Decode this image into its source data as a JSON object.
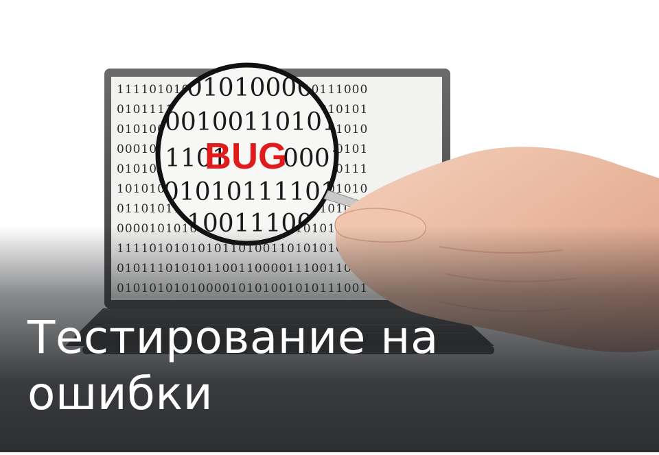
{
  "photo": {
    "bug_label": "BUG",
    "binary_rows_screen": [
      "1111010101010000101000010111000",
      "0101111010101011001010101010101",
      "0101000100110101001100101011010",
      "0001011101000100011100101110101",
      "0101000100101000001010001010111",
      "1010101010111101011011000101010",
      "0110101110110001011001010101010",
      "0000101010011100010110101010101",
      "1111010101010110100110101010101",
      "0101110101011001100001110011010",
      "0101010101000010101001010111001"
    ],
    "lens_rows": [
      "01010000",
      "001001101011",
      "1101",
      "0001",
      "0101011110101",
      "100111000"
    ]
  },
  "caption": {
    "line1": "Тестирование на",
    "line2": "ошибки"
  }
}
